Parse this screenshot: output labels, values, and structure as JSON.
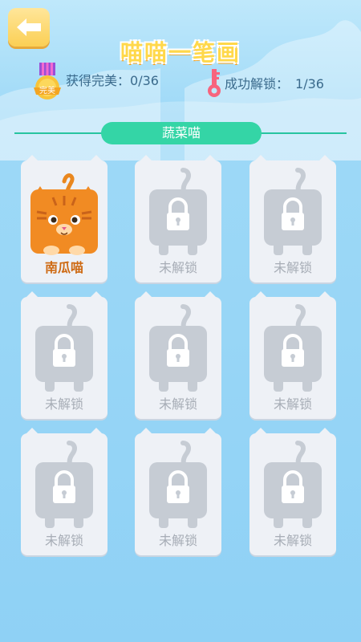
{
  "header": {
    "title": "喵喵一笔画",
    "back_icon": "arrow-left-icon"
  },
  "stats": {
    "medal_text": "完美",
    "perfect_label": "获得完美：",
    "perfect_value": "0/36",
    "unlock_label": "成功解锁：",
    "unlock_value": "1/36"
  },
  "category": {
    "label": "蔬菜喵"
  },
  "levels": [
    {
      "label": "南瓜喵",
      "unlocked": true
    },
    {
      "label": "未解锁",
      "unlocked": false
    },
    {
      "label": "未解锁",
      "unlocked": false
    },
    {
      "label": "未解锁",
      "unlocked": false
    },
    {
      "label": "未解锁",
      "unlocked": false
    },
    {
      "label": "未解锁",
      "unlocked": false
    },
    {
      "label": "未解锁",
      "unlocked": false
    },
    {
      "label": "未解锁",
      "unlocked": false
    },
    {
      "label": "未解锁",
      "unlocked": false
    }
  ],
  "colors": {
    "accent": "#34d5a6",
    "title": "#ffd84a",
    "active_label": "#ce6a13",
    "locked_label": "#a7adb6"
  }
}
